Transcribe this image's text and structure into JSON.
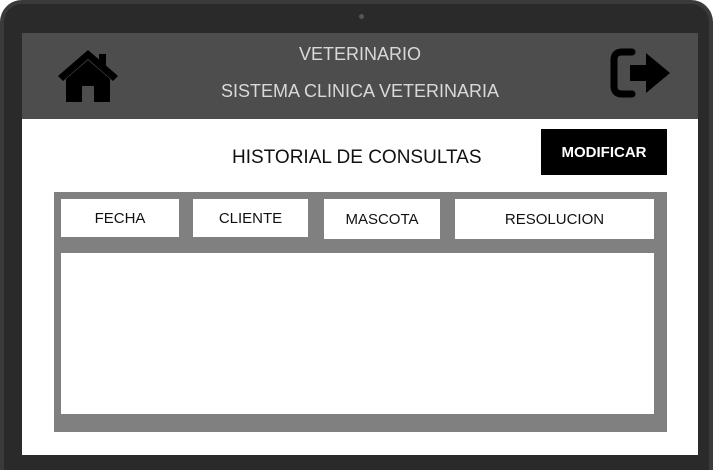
{
  "header": {
    "title": "VETERINARIO",
    "subtitle": "SISTEMA CLINICA VETERINARIA",
    "home_icon": "home-icon",
    "exit_icon": "logout-icon"
  },
  "main": {
    "page_title": "HISTORIAL DE CONSULTAS",
    "modify_label": "MODIFICAR"
  },
  "table": {
    "columns": [
      "FECHA",
      "CLIENTE",
      "MASCOTA",
      "RESOLUCION"
    ],
    "rows": []
  },
  "colors": {
    "header_bg": "#4d4d4d",
    "panel_bg": "#808080",
    "button_bg": "#000000",
    "frame": "#2a2a2a"
  }
}
